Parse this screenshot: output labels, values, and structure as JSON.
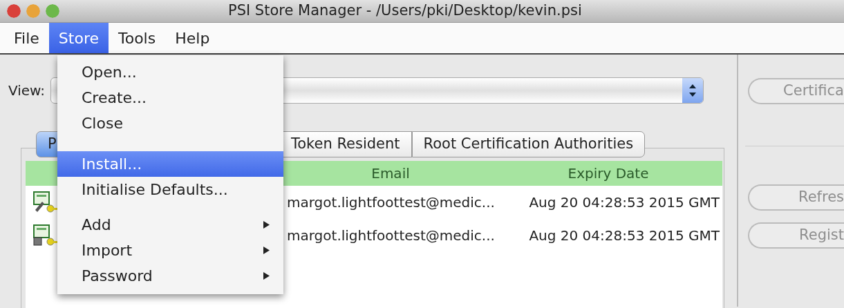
{
  "window": {
    "title": "PSI Store Manager - /Users/pki/Desktop/kevin.psi"
  },
  "menu_bar": [
    {
      "label": "File",
      "selected": false
    },
    {
      "label": "Store",
      "selected": true
    },
    {
      "label": "Tools",
      "selected": false
    },
    {
      "label": "Help",
      "selected": false
    }
  ],
  "open_menu": {
    "items": [
      {
        "kind": "item",
        "label": "Open...",
        "selected": false
      },
      {
        "kind": "item",
        "label": "Create...",
        "selected": false
      },
      {
        "kind": "item",
        "label": "Close",
        "selected": false
      },
      {
        "kind": "item",
        "label": "Install...",
        "selected": true
      },
      {
        "kind": "item",
        "label": "Initialise Defaults...",
        "selected": false
      },
      {
        "kind": "submenu",
        "label": "Add",
        "selected": false
      },
      {
        "kind": "submenu",
        "label": "Import",
        "selected": false
      },
      {
        "kind": "submenu",
        "label": "Password",
        "selected": false
      }
    ]
  },
  "view": {
    "label": "View:"
  },
  "tabs": [
    {
      "label": "P",
      "selected": true
    },
    {
      "label": "Token Resident",
      "selected": false
    },
    {
      "label": "Root Certification Authorities",
      "selected": false
    }
  ],
  "table": {
    "columns": [
      "Email",
      "Expiry Date"
    ],
    "rows": [
      {
        "kind": "pen",
        "email": "margot.lightfoottest@medic...",
        "expiry": "Aug 20 04:28:53 2015 GMT"
      },
      {
        "kind": "chip",
        "email": "margot.lightfoottest@medic...",
        "expiry": "Aug 20 04:28:53 2015 GMT"
      }
    ]
  },
  "side_buttons": [
    {
      "label": "Certifica",
      "disabled": true
    },
    {
      "label": "Refres",
      "disabled": true
    },
    {
      "label": "Regist",
      "disabled": true
    }
  ]
}
